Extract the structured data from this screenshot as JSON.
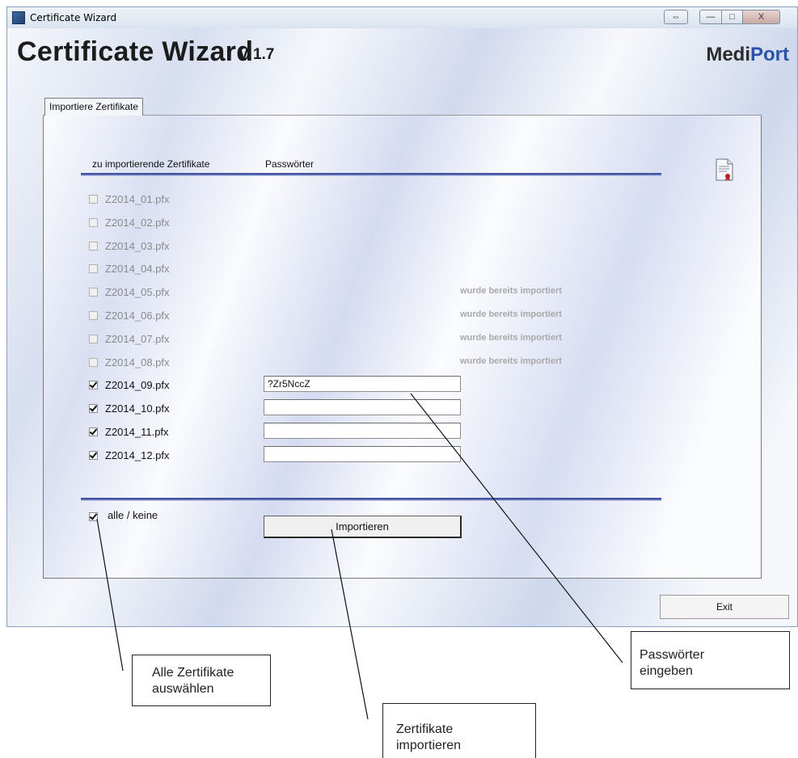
{
  "window": {
    "title": "Certificate Wizard",
    "controls": {
      "resize": "⇔",
      "minimize": "—",
      "maximize": "□",
      "close": "X"
    }
  },
  "header": {
    "title": "Certificate Wizard",
    "version": "V 1.7",
    "brand_part1": "Medi",
    "brand_part2": "Port"
  },
  "tab": {
    "label": "Importiere Zertifikate"
  },
  "columns": {
    "certificates": "zu importierende Zertifikate",
    "passwords": "Passwörter"
  },
  "certificates": [
    {
      "file": "Z2014_01.pfx",
      "checked": false,
      "enabled": false,
      "status": "",
      "password": null
    },
    {
      "file": "Z2014_02.pfx",
      "checked": false,
      "enabled": false,
      "status": "",
      "password": null
    },
    {
      "file": "Z2014_03.pfx",
      "checked": false,
      "enabled": false,
      "status": "",
      "password": null
    },
    {
      "file": "Z2014_04.pfx",
      "checked": false,
      "enabled": false,
      "status": "",
      "password": null
    },
    {
      "file": "Z2014_05.pfx",
      "checked": false,
      "enabled": false,
      "status": "wurde bereits importiert",
      "password": null
    },
    {
      "file": "Z2014_06.pfx",
      "checked": false,
      "enabled": false,
      "status": "wurde bereits importiert",
      "password": null
    },
    {
      "file": "Z2014_07.pfx",
      "checked": false,
      "enabled": false,
      "status": "wurde bereits importiert",
      "password": null
    },
    {
      "file": "Z2014_08.pfx",
      "checked": false,
      "enabled": false,
      "status": "wurde bereits importiert",
      "password": null
    },
    {
      "file": "Z2014_09.pfx",
      "checked": true,
      "enabled": true,
      "status": "",
      "password": "?Zr5NccZ"
    },
    {
      "file": "Z2014_10.pfx",
      "checked": true,
      "enabled": true,
      "status": "",
      "password": ""
    },
    {
      "file": "Z2014_11.pfx",
      "checked": true,
      "enabled": true,
      "status": "",
      "password": ""
    },
    {
      "file": "Z2014_12.pfx",
      "checked": true,
      "enabled": true,
      "status": "",
      "password": ""
    }
  ],
  "select_all": {
    "label": "alle / keine",
    "checked": true
  },
  "buttons": {
    "import": "Importieren",
    "exit": "Exit"
  },
  "callouts": {
    "select_all": [
      "Alle Zertifikate",
      "auswählen"
    ],
    "import": [
      "Zertifikate",
      "importieren"
    ],
    "passwords": [
      "Passwörter",
      "eingeben"
    ]
  },
  "icons": {
    "app": "certificate-wizard-app-icon",
    "document": "certificate-document-icon"
  },
  "colors": {
    "brand_blue": "#2a53a8",
    "rule_blue": "#2f3f8c",
    "imported_gray": "#a9a9a9"
  }
}
